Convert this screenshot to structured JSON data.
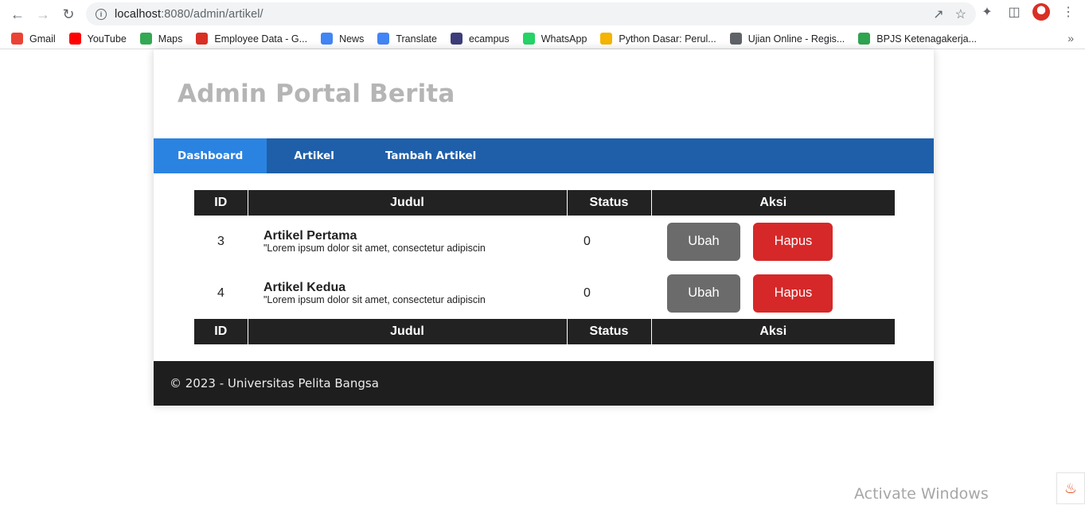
{
  "browser": {
    "url_host": "localhost",
    "url_rest": ":8080/admin/artikel/",
    "bookmarks": [
      {
        "label": "Gmail",
        "icon": "gmail-icon",
        "color": "#ea4335"
      },
      {
        "label": "YouTube",
        "icon": "youtube-icon",
        "color": "#ff0000"
      },
      {
        "label": "Maps",
        "icon": "maps-icon",
        "color": "#34a853"
      },
      {
        "label": "Employee Data - G...",
        "icon": "grp-icon",
        "color": "#d93025"
      },
      {
        "label": "News",
        "icon": "news-icon",
        "color": "#4285f4"
      },
      {
        "label": "Translate",
        "icon": "translate-icon",
        "color": "#4285f4"
      },
      {
        "label": "ecampus",
        "icon": "ecampus-icon",
        "color": "#3c3c7a"
      },
      {
        "label": "WhatsApp",
        "icon": "whatsapp-icon",
        "color": "#25d366"
      },
      {
        "label": "Python Dasar: Perul...",
        "icon": "python-icon",
        "color": "#f4b400"
      },
      {
        "label": "Ujian Online - Regis...",
        "icon": "globe-icon",
        "color": "#5f6368"
      },
      {
        "label": "BPJS Ketenagakerja...",
        "icon": "bpjs-icon",
        "color": "#2ea44f"
      }
    ]
  },
  "site": {
    "title": "Admin Portal Berita",
    "nav": [
      {
        "label": "Dashboard",
        "active": true
      },
      {
        "label": "Artikel",
        "active": false
      },
      {
        "label": "Tambah Artikel",
        "active": false
      }
    ],
    "table": {
      "headers": [
        "ID",
        "Judul",
        "Status",
        "Aksi"
      ],
      "rows": [
        {
          "id": "3",
          "title": "Artikel Pertama",
          "excerpt": "\"Lorem ipsum dolor sit amet, consectetur adipiscin",
          "status": "0",
          "edit_label": "Ubah",
          "delete_label": "Hapus"
        },
        {
          "id": "4",
          "title": "Artikel Kedua",
          "excerpt": "\"Lorem ipsum dolor sit amet, consectetur adipiscin",
          "status": "0",
          "edit_label": "Ubah",
          "delete_label": "Hapus"
        }
      ]
    },
    "footer": "© 2023 - Universitas Pelita Bangsa"
  },
  "os": {
    "watermark": "Activate Windows"
  },
  "colors": {
    "nav_bg": "#1f5faa",
    "nav_active": "#2b83e1",
    "header_bg": "#222222",
    "edit_btn": "#6b6b6b",
    "delete_btn": "#d62828",
    "footer_bg": "#1e1e1e"
  }
}
